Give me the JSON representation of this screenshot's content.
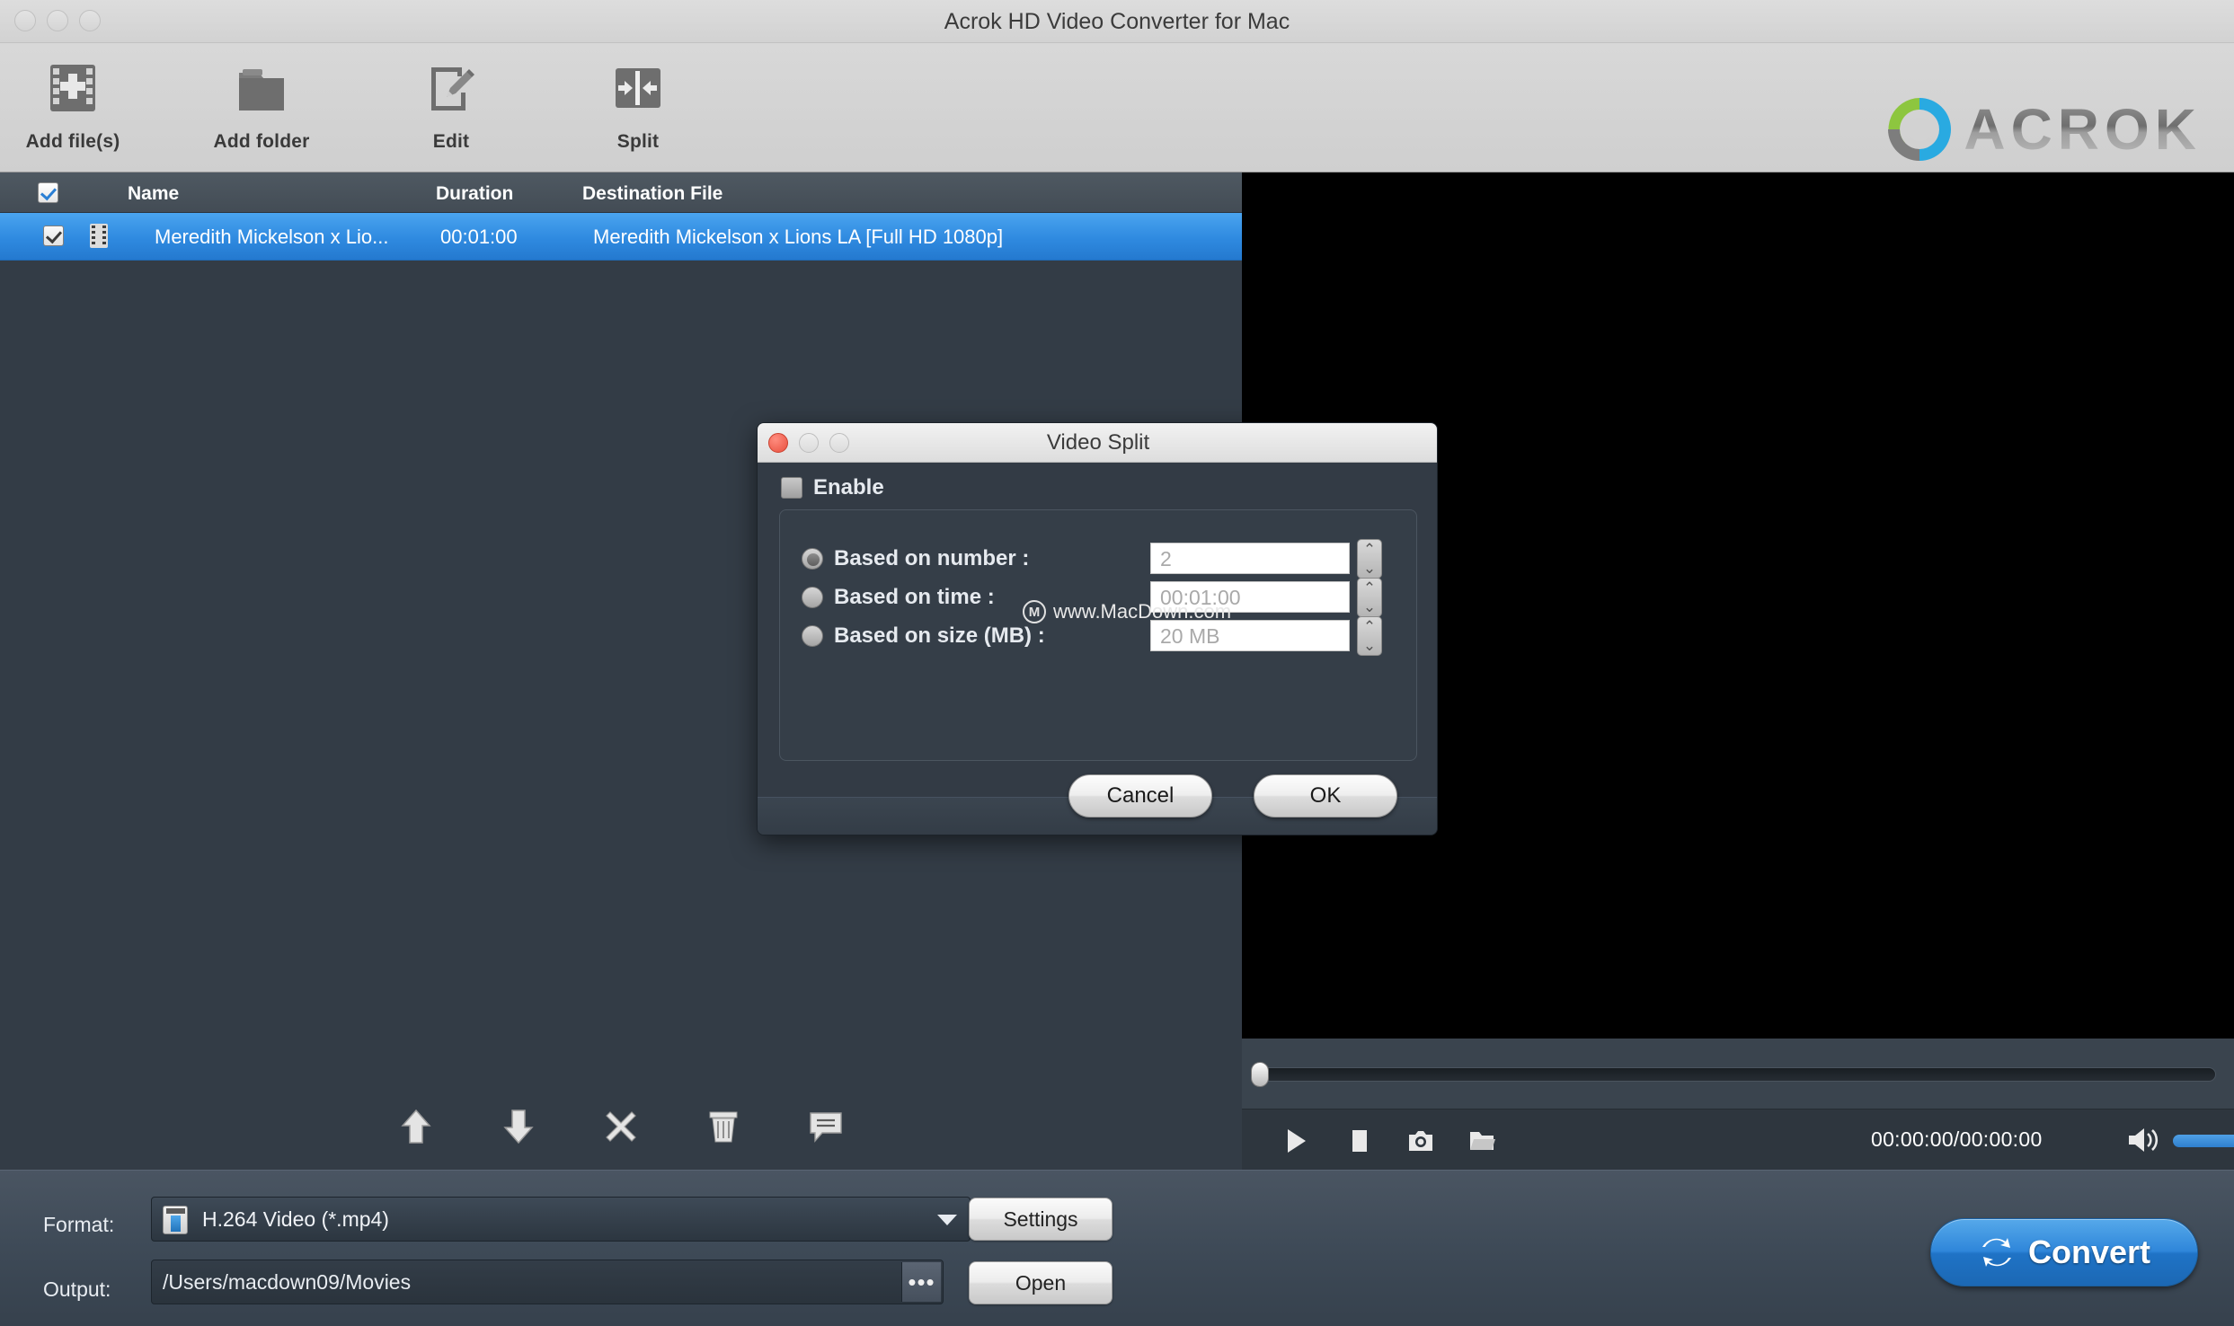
{
  "window": {
    "title": "Acrok HD Video Converter for Mac",
    "brand": "ACROK"
  },
  "toolbar": {
    "items": [
      {
        "label": "Add file(s)",
        "icon": "film-plus-icon"
      },
      {
        "label": "Add folder",
        "icon": "folder-icon"
      },
      {
        "label": "Edit",
        "icon": "pencil-edit-icon"
      },
      {
        "label": "Split",
        "icon": "split-arrows-icon"
      }
    ]
  },
  "file_list": {
    "columns": [
      "Name",
      "Duration",
      "Destination File"
    ],
    "select_all_checked": true,
    "rows": [
      {
        "checked": true,
        "name": "Meredith Mickelson x Lio...",
        "duration": "00:01:00",
        "destination": "Meredith Mickelson x Lions LA [Full HD 1080p]",
        "selected": true
      }
    ],
    "actions": [
      {
        "name": "move-up",
        "icon": "arrow-up-icon"
      },
      {
        "name": "move-down",
        "icon": "arrow-down-icon"
      },
      {
        "name": "remove",
        "icon": "close-x-icon"
      },
      {
        "name": "clear-all",
        "icon": "trash-icon"
      },
      {
        "name": "comment",
        "icon": "comment-icon"
      }
    ]
  },
  "player": {
    "time_display": "00:00:00/00:00:00",
    "seek_position_pct": 1,
    "volume_pct": 92,
    "controls": [
      {
        "name": "play",
        "icon": "play-icon"
      },
      {
        "name": "stop",
        "icon": "stop-icon"
      },
      {
        "name": "snapshot",
        "icon": "camera-icon"
      },
      {
        "name": "open-folder",
        "icon": "folder-open-icon"
      }
    ],
    "volume_icon": "speaker-icon"
  },
  "bottom": {
    "format_label": "Format:",
    "format_value": "H.264 Video (*.mp4)",
    "format_icon": "video-file-icon",
    "output_label": "Output:",
    "output_value": "/Users/macdown09/Movies",
    "browse_label": "•••",
    "settings_label": "Settings",
    "open_label": "Open",
    "convert_label": "Convert",
    "convert_icon": "refresh-cycle-icon"
  },
  "dialog": {
    "title": "Video Split",
    "enable_label": "Enable",
    "enable_checked": false,
    "options": [
      {
        "label": "Based on number :",
        "value": "2",
        "selected": true
      },
      {
        "label": "Based on time :",
        "value": "00:01:00",
        "selected": false
      },
      {
        "label": "Based on size (MB) :",
        "value": "20 MB",
        "selected": false
      }
    ],
    "watermark": "www.MacDown.com",
    "watermark_logo": "M",
    "cancel_label": "Cancel",
    "ok_label": "OK",
    "stepper_up": "⌃",
    "stepper_down": "⌄"
  },
  "colors": {
    "selection_blue": "#2f8ae0",
    "panel_dark": "#333c46",
    "convert_blue": "#2f86da",
    "titlebar_gray": "#d5d5d5"
  }
}
